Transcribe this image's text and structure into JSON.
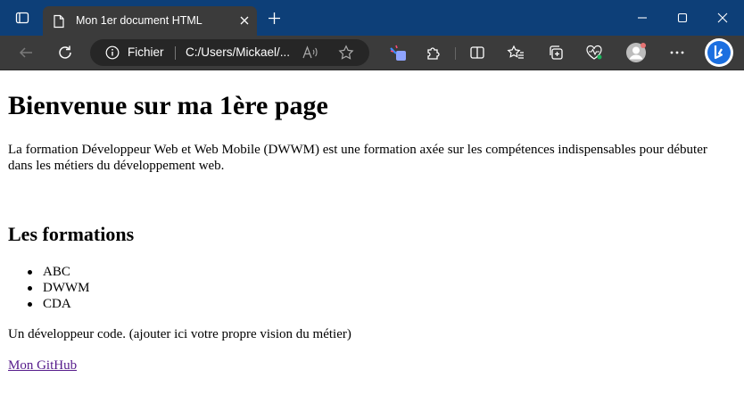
{
  "browser": {
    "tab": {
      "title": "Mon 1er document HTML"
    },
    "address_bar": {
      "scheme_label": "Fichier",
      "url": "C:/Users/Mickael/..."
    }
  },
  "page": {
    "heading": "Bienvenue sur ma 1ère page",
    "intro": "La formation Développeur Web et Web Mobile (DWWM) est une formation axée sur les compétences indispensables pour débuter dans les métiers du développement web.",
    "subheading": "Les formations",
    "formations": [
      "ABC",
      "DWWM",
      "CDA"
    ],
    "vision": "Un développeur code. (ajouter ici votre propre vision du métier)",
    "github_link": "Mon GitHub"
  },
  "colors": {
    "titlebar": "#0d3f78",
    "toolbar": "#3b3b3b",
    "link_visited": "#551a8b"
  },
  "icons": {
    "titlebar": [
      "tab-actions-icon",
      "page-icon",
      "close-icon",
      "new-tab-icon",
      "minimize-icon",
      "maximize-icon",
      "window-close-icon"
    ],
    "toolbar": [
      "back-icon",
      "refresh-icon",
      "info-icon",
      "read-aloud-icon",
      "favorite-star-icon",
      "extension-icon",
      "puzzle-icon",
      "split-screen-icon",
      "favorites-icon",
      "collections-icon",
      "performance-icon",
      "profile-avatar",
      "more-icon",
      "copilot-icon"
    ]
  }
}
